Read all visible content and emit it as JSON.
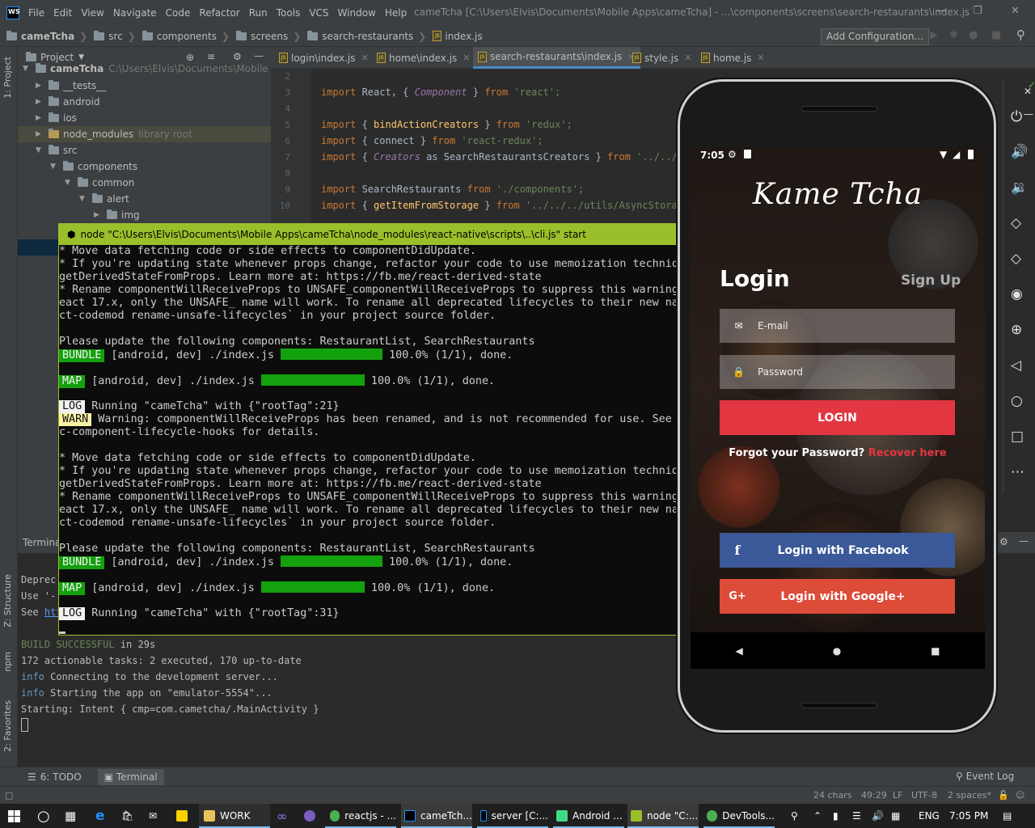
{
  "menubar": {
    "items": [
      "File",
      "Edit",
      "View",
      "Navigate",
      "Code",
      "Refactor",
      "Run",
      "Tools",
      "VCS",
      "Window",
      "Help"
    ],
    "title": "cameTcha [C:\\Users\\Elvis\\Documents\\Mobile Apps\\cameTcha] - ...\\components\\screens\\search-restaurants\\index.js"
  },
  "breadcrumbs": [
    "cameTcha",
    "src",
    "components",
    "screens",
    "search-restaurants",
    "index.js"
  ],
  "toolbar": {
    "add_config": "Add Configuration..."
  },
  "left_strip": {
    "project": "1: Project",
    "structure": "Z: Structure",
    "npm": "npm",
    "favorites": "2: Favorites"
  },
  "project": {
    "header": "Project",
    "root": "cameTcha",
    "root_path": "C:\\Users\\Elvis\\Documents\\Mobile Apps\\cameTcha",
    "items": [
      {
        "label": "__tests__"
      },
      {
        "label": "android"
      },
      {
        "label": "ios"
      },
      {
        "label": "node_modules",
        "note": "library root"
      },
      {
        "label": "src"
      },
      {
        "label": "components"
      },
      {
        "label": "common"
      },
      {
        "label": "alert"
      },
      {
        "label": "img"
      }
    ]
  },
  "tabs": [
    {
      "label": "login\\index.js"
    },
    {
      "label": "home\\index.js"
    },
    {
      "label": "search-restaurants\\index.js"
    },
    {
      "label": "style.js"
    },
    {
      "label": "home.js"
    }
  ],
  "code": {
    "line_numbers": [
      "2",
      "3",
      "4",
      "5",
      "6",
      "7",
      "8",
      "9",
      "10"
    ],
    "lines": [
      {
        "a": "import",
        "b": " React, { ",
        "c": "Component",
        "d": " } ",
        "e": "from",
        "f": " 'react';"
      },
      {
        "a": "import",
        "b": " { ",
        "c": "bindActionCreators",
        "d": " } ",
        "e": "from",
        "f": " 'redux';"
      },
      {
        "a": "import",
        "b": " { connect } ",
        "e": "from",
        "f": " 'react-redux';"
      },
      {
        "a": "import",
        "b": " { ",
        "c": "Creators",
        "d": " as SearchRestaurantsCreators } ",
        "e": "from",
        "f": " '../../../"
      },
      {
        "a": "import",
        "b": " SearchRestaurants ",
        "e": "from",
        "f": " './components';"
      },
      {
        "a": "import",
        "b": " { ",
        "c": "getItemFromStorage",
        "d": " } ",
        "e": "from",
        "f": " '../../../utils/AsyncStorage"
      }
    ]
  },
  "console": {
    "title": "node  \"C:\\Users\\Elvis\\Documents\\Mobile Apps\\cameTcha\\node_modules\\react-native\\scripts\\..\\cli.js\" start",
    "lines": [
      "* Move data fetching code or side effects to componentDidUpdate.",
      "* If you're updating state whenever props change, refactor your code to use memoization techniqu",
      "getDerivedStateFromProps. Learn more at: https://fb.me/react-derived-state",
      "* Rename componentWillReceiveProps to UNSAFE_componentWillReceiveProps to suppress this warning",
      "eact 17.x, only the UNSAFE_ name will work. To rename all deprecated lifecycles to their new nam",
      "ct-codemod rename-unsafe-lifecycles` in your project source folder.",
      "",
      "Please update the following components: RestaurantList, SearchRestaurants"
    ],
    "bundle1": {
      "badge": "BUNDLE",
      "text": " [android, dev] ./index.js ",
      "pct": " 100.0% (1/1), done."
    },
    "map1": {
      "badge": "MAP",
      "text": " [android, dev] ./index.js ",
      "pct": " 100.0% (1/1), done."
    },
    "log1": {
      "badge": "LOG",
      "text": " Running \"cameTcha\" with {\"rootTag\":21}"
    },
    "warn1": {
      "badge": "WARN",
      "text": " Warning: componentWillReceiveProps has been renamed, and is not recommended for use. See"
    },
    "warn_cont": "c-component-lifecycle-hooks for details.",
    "bundle2": {
      "badge": "BUNDLE",
      "text": " [android, dev] ./index.js ",
      "pct": " 100.0% (1/1), done."
    },
    "map2": {
      "badge": "MAP",
      "text": " [android, dev] ./index.js ",
      "pct": " 100.0% (1/1), done."
    },
    "log2": {
      "badge": "LOG",
      "text": " Running \"cameTcha\" with {\"rootTag\":31}"
    }
  },
  "terminal": {
    "header": "Termina",
    "lines": {
      "deprecated": "Deprec",
      "use": "Use '-",
      "see": "See ",
      "see_link": "htt",
      "build": "BUILD SUCCESSFUL",
      "build_time": " in 29s",
      "tasks": "172 actionable tasks: 2 executed, 170 up-to-date",
      "info1_tag": "info",
      "info1": " Connecting to the development server...",
      "info2_tag": "info",
      "info2": " Starting the app on \"emulator-5554\"...",
      "starting": "Starting: Intent { cmp=com.cametcha/.MainActivity }"
    }
  },
  "bottom_tabs": {
    "todo": "6: TODO",
    "terminal": "Terminal",
    "event_log": "Event Log"
  },
  "status": {
    "chars": "24 chars",
    "pos": "49:29",
    "lf": "LF",
    "enc": "UTF-8",
    "indent": "2 spaces*"
  },
  "taskbar": {
    "items": [
      "WORK",
      "reactjs - ...",
      "cameTch...",
      "server [C:...",
      "Android ...",
      "node \"C:...",
      "DevTools..."
    ],
    "lang": "ENG",
    "time": "7:05 PM"
  },
  "phone": {
    "time": "7:05",
    "brand": "Kame Tcha",
    "login_title": "Login",
    "signup": "Sign Up",
    "email_placeholder": "E-mail",
    "password_placeholder": "Password",
    "login_button": "LOGIN",
    "forgot": "Forgot your Password?",
    "recover": "Recover here",
    "facebook": "Login with Facebook",
    "google": "Login with Google+",
    "colors": {
      "accent": "#e23641",
      "facebook": "#3b5998",
      "google": "#dd4b39"
    }
  }
}
